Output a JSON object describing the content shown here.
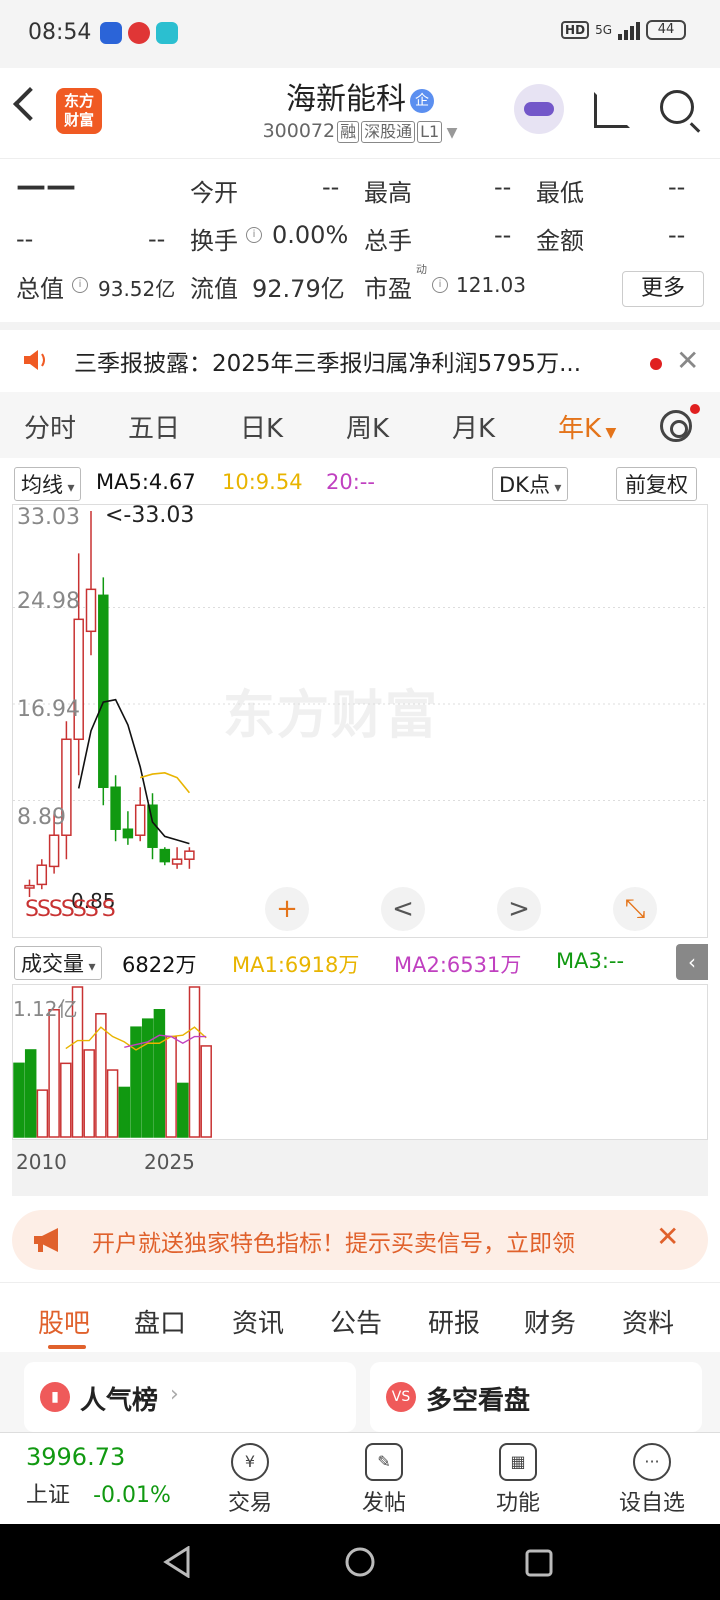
{
  "status_bar": {
    "time": "08:54",
    "network": "5G",
    "hd": "HD",
    "battery": "44"
  },
  "header": {
    "logo_line1": "东方",
    "logo_line2": "财富",
    "stock_name": "海新能科",
    "corp_badge": "企",
    "stock_code": "300072",
    "tags": [
      "融",
      "深股通",
      "L1"
    ]
  },
  "quote": {
    "price": "——",
    "change": "--",
    "change_pct": "--",
    "open_label": "今开",
    "open": "--",
    "high_label": "最高",
    "high": "--",
    "low_label": "最低",
    "low": "--",
    "turnover_label": "换手",
    "turnover": "0.00%",
    "volume_label": "总手",
    "volume": "--",
    "amount_label": "金额",
    "amount": "--",
    "mcap_label": "总值",
    "mcap": "93.52亿",
    "float_label": "流值",
    "float_cap": "92.79亿",
    "pe_label": "市盈",
    "pe_sup": "动",
    "pe": "121.03",
    "more_label": "更多"
  },
  "notice": {
    "text": "三季报披露：2025年三季报归属净利润5795万..."
  },
  "period_tabs": {
    "items": [
      "分时",
      "五日",
      "日K",
      "周K",
      "月K",
      "年K"
    ],
    "active": "年K"
  },
  "ma_header": {
    "selector": "均线",
    "ma5": "MA5:4.67",
    "ma10": "10:9.54",
    "ma20": "20:--",
    "dk_label": "DK点",
    "adjust_label": "前复权",
    "colors": {
      "ma5": "#111111",
      "ma10": "#e8b400",
      "ma20": "#c040c0",
      "up": "#c83232",
      "down": "#119911"
    }
  },
  "main_chart": {
    "watermark": "东方财富",
    "y_labels": [
      "33.03",
      "24.98",
      "16.94",
      "8.89"
    ],
    "max_marker": "<-33.03",
    "min_marker": "0.85",
    "signals": "SSSSSS S",
    "controls": [
      "+",
      "<",
      ">",
      "⤡"
    ]
  },
  "chart_data": [
    {
      "type": "candlestick",
      "title": "",
      "xlabel": "",
      "ylabel": "",
      "ylim": [
        0.85,
        33.03
      ],
      "series": [
        {
          "open": 1.6,
          "close": 1.8,
          "high": 2.3,
          "low": 0.85
        },
        {
          "open": 1.9,
          "close": 3.5,
          "high": 4.0,
          "low": 1.5
        },
        {
          "open": 3.4,
          "close": 6.0,
          "high": 7.8,
          "low": 2.8
        },
        {
          "open": 6.0,
          "close": 14.0,
          "high": 15.5,
          "low": 4.0
        },
        {
          "open": 14.0,
          "close": 24.0,
          "high": 29.5,
          "low": 11.0
        },
        {
          "open": 23.0,
          "close": 26.5,
          "high": 33.03,
          "low": 21.0
        },
        {
          "open": 26.0,
          "close": 10.0,
          "high": 27.5,
          "low": 8.5
        },
        {
          "open": 10.0,
          "close": 6.5,
          "high": 11.0,
          "low": 5.5
        },
        {
          "open": 6.5,
          "close": 5.8,
          "high": 8.0,
          "low": 5.2
        },
        {
          "open": 6.0,
          "close": 8.5,
          "high": 10.0,
          "low": 5.5
        },
        {
          "open": 8.5,
          "close": 5.0,
          "high": 9.5,
          "low": 4.0
        },
        {
          "open": 4.8,
          "close": 3.8,
          "high": 5.0,
          "low": 3.5
        },
        {
          "open": 3.6,
          "close": 4.0,
          "high": 5.0,
          "low": 3.2
        },
        {
          "open": 4.0,
          "close": 4.67,
          "high": 5.0,
          "low": 3.2
        }
      ],
      "ma5": [
        null,
        null,
        null,
        null,
        9.9,
        14.7,
        17.1,
        17.3,
        15.2,
        11.7,
        7.1,
        5.9,
        5.6,
        5.3
      ],
      "ma10": [
        null,
        null,
        null,
        null,
        null,
        null,
        null,
        null,
        null,
        10.8,
        11.1,
        11.2,
        10.8,
        9.54
      ]
    },
    {
      "type": "bar",
      "title": "成交量",
      "ylabel_top": "1.12亿",
      "x_labels": [
        "2010",
        "2025"
      ],
      "values": [
        0.55,
        0.65,
        0.35,
        0.95,
        0.55,
        1.12,
        0.65,
        0.92,
        0.5,
        0.37,
        0.82,
        0.88,
        0.95,
        0.75,
        0.4,
        1.12,
        0.68
      ],
      "up": [
        false,
        false,
        true,
        true,
        true,
        true,
        true,
        true,
        true,
        false,
        false,
        false,
        false,
        true,
        false,
        true,
        true
      ],
      "ma1": [
        null,
        null,
        null,
        null,
        0.66,
        0.72,
        0.72,
        0.82,
        0.75,
        0.71,
        0.65,
        0.7,
        0.7,
        0.75,
        0.76,
        0.82,
        0.74
      ],
      "ma2": [
        null,
        null,
        null,
        null,
        null,
        null,
        null,
        null,
        null,
        0.67,
        0.69,
        0.71,
        0.76,
        0.75,
        0.7,
        0.75,
        0.75
      ]
    }
  ],
  "volume_header": {
    "selector": "成交量",
    "value": "6822万",
    "ma1": "MA1:6918万",
    "ma2": "MA2:6531万",
    "ma3": "MA3:--"
  },
  "promo": {
    "text": "开户就送独家特色指标！提示买卖信号，立即领"
  },
  "bottom_tabs": {
    "items": [
      "股吧",
      "盘口",
      "资讯",
      "公告",
      "研报",
      "财务",
      "资料"
    ],
    "active": "股吧"
  },
  "cards": [
    {
      "icon": "bar-chart-icon",
      "label": "人气榜"
    },
    {
      "icon": "vs-icon",
      "label": "多空看盘"
    }
  ],
  "bottom_nav": {
    "index_value": "3996.73",
    "index_name": "上证",
    "index_change": "-0.01%",
    "items": [
      {
        "label": "交易",
        "icon": "yen-icon"
      },
      {
        "label": "发帖",
        "icon": "edit-icon"
      },
      {
        "label": "功能",
        "icon": "grid-icon"
      },
      {
        "label": "设自选",
        "icon": "more-icon"
      }
    ]
  }
}
